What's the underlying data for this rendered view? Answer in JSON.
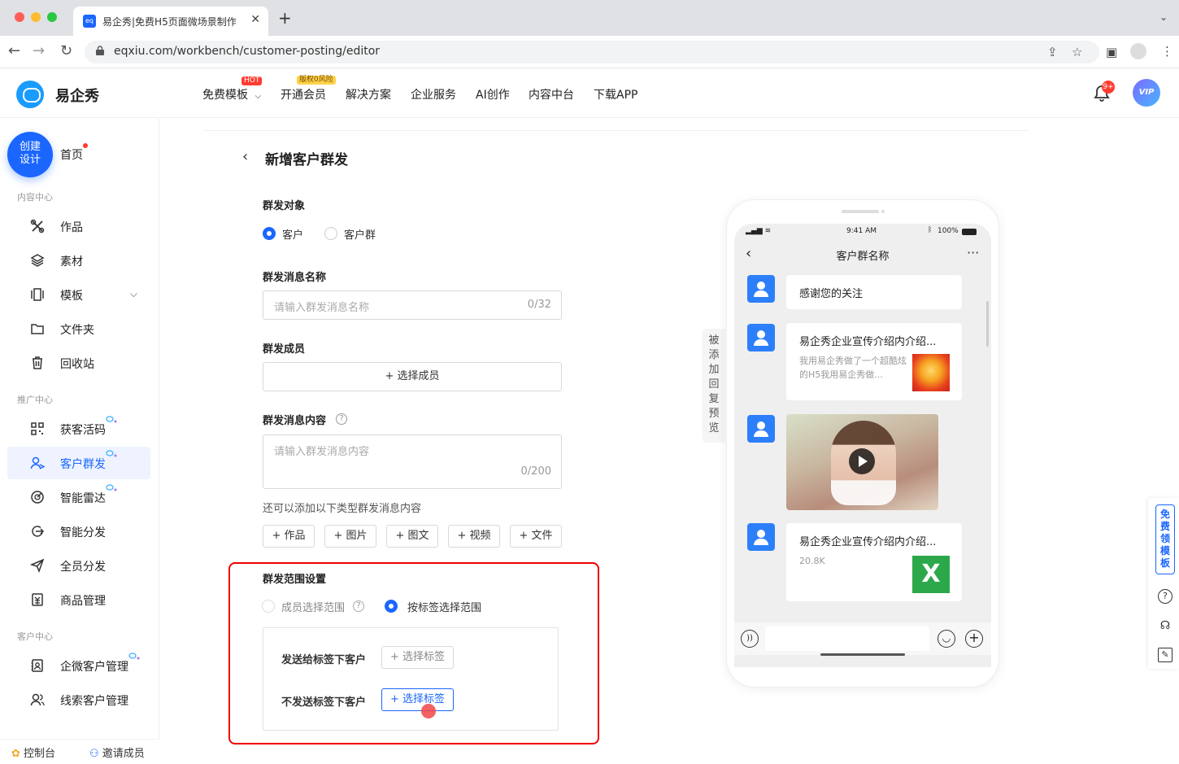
{
  "browser": {
    "tab_title": "易企秀|免费H5页面微场景制作",
    "tab_favicon_text": "eq",
    "url": "eqxiu.com/workbench/customer-posting/editor"
  },
  "header": {
    "brand": "易企秀",
    "nav": [
      {
        "label": "免费模板",
        "badge": "HOT",
        "dropdown": true
      },
      {
        "label": "开通会员",
        "badge": "版权0风险"
      },
      {
        "label": "解决方案"
      },
      {
        "label": "企业服务"
      },
      {
        "label": "AI创作"
      },
      {
        "label": "内容中台"
      },
      {
        "label": "下载APP"
      }
    ],
    "notification_count": "9+",
    "avatar_text": "VIP"
  },
  "sidebar": {
    "create_button": "创建设计",
    "create_line1": "创建",
    "create_line2": "设计",
    "home": "首页",
    "sections": [
      {
        "title": "内容中心",
        "items": [
          "作品",
          "素材",
          "模板",
          "文件夹",
          "回收站"
        ]
      },
      {
        "title": "推广中心",
        "items": [
          "获客活码",
          "客户群发",
          "智能雷达",
          "智能分发",
          "全员分发",
          "商品管理"
        ]
      },
      {
        "title": "客户中心",
        "items": [
          "企微客户管理",
          "线索客户管理"
        ]
      }
    ],
    "active_item": "客户群发",
    "bottom": {
      "console": "控制台",
      "invite": "邀请成员"
    }
  },
  "form": {
    "back": "<",
    "title": "新增客户群发",
    "target": {
      "label": "群发对象",
      "options": [
        "客户",
        "客户群"
      ],
      "selected": "客户"
    },
    "name": {
      "label": "群发消息名称",
      "placeholder": "请输入群发消息名称",
      "counter": "0/32"
    },
    "members": {
      "label": "群发成员",
      "button": "+ 选择成员"
    },
    "content": {
      "label": "群发消息内容",
      "placeholder": "请输入群发消息内容",
      "counter": "0/200",
      "hint": "还可以添加以下类型群发消息内容",
      "types": [
        "+ 作品",
        "+ 图片",
        "+ 图文",
        "+ 视频",
        "+ 文件"
      ]
    },
    "range": {
      "label": "群发范围设置",
      "options": [
        "成员选择范围",
        "按标签选择范围"
      ],
      "selected": "按标签选择范围",
      "send_to_label": "发送给标签下客户",
      "exclude_label": "不发送标签下客户",
      "select_tag_button": "+ 选择标签"
    }
  },
  "preview": {
    "tab_label": "被添加回复预览",
    "status_time": "9:41 AM",
    "status_battery": "100%",
    "chat_title": "客户群名称",
    "messages": [
      {
        "type": "text",
        "text": "感谢您的关注"
      },
      {
        "type": "link",
        "title": "易企秀企业宣传介绍内介绍...",
        "desc": "我用易企秀做了一个超酷炫的H5我用易企秀做..."
      },
      {
        "type": "video"
      },
      {
        "type": "file",
        "title": "易企秀企业宣传介绍内介绍...",
        "size": "20.8K"
      }
    ]
  },
  "right_tools": {
    "free_template": "免费领模板"
  },
  "colors": {
    "primary": "#1a66ff",
    "highlight_box": "#e00000",
    "badge_red": "#ff3b30"
  }
}
